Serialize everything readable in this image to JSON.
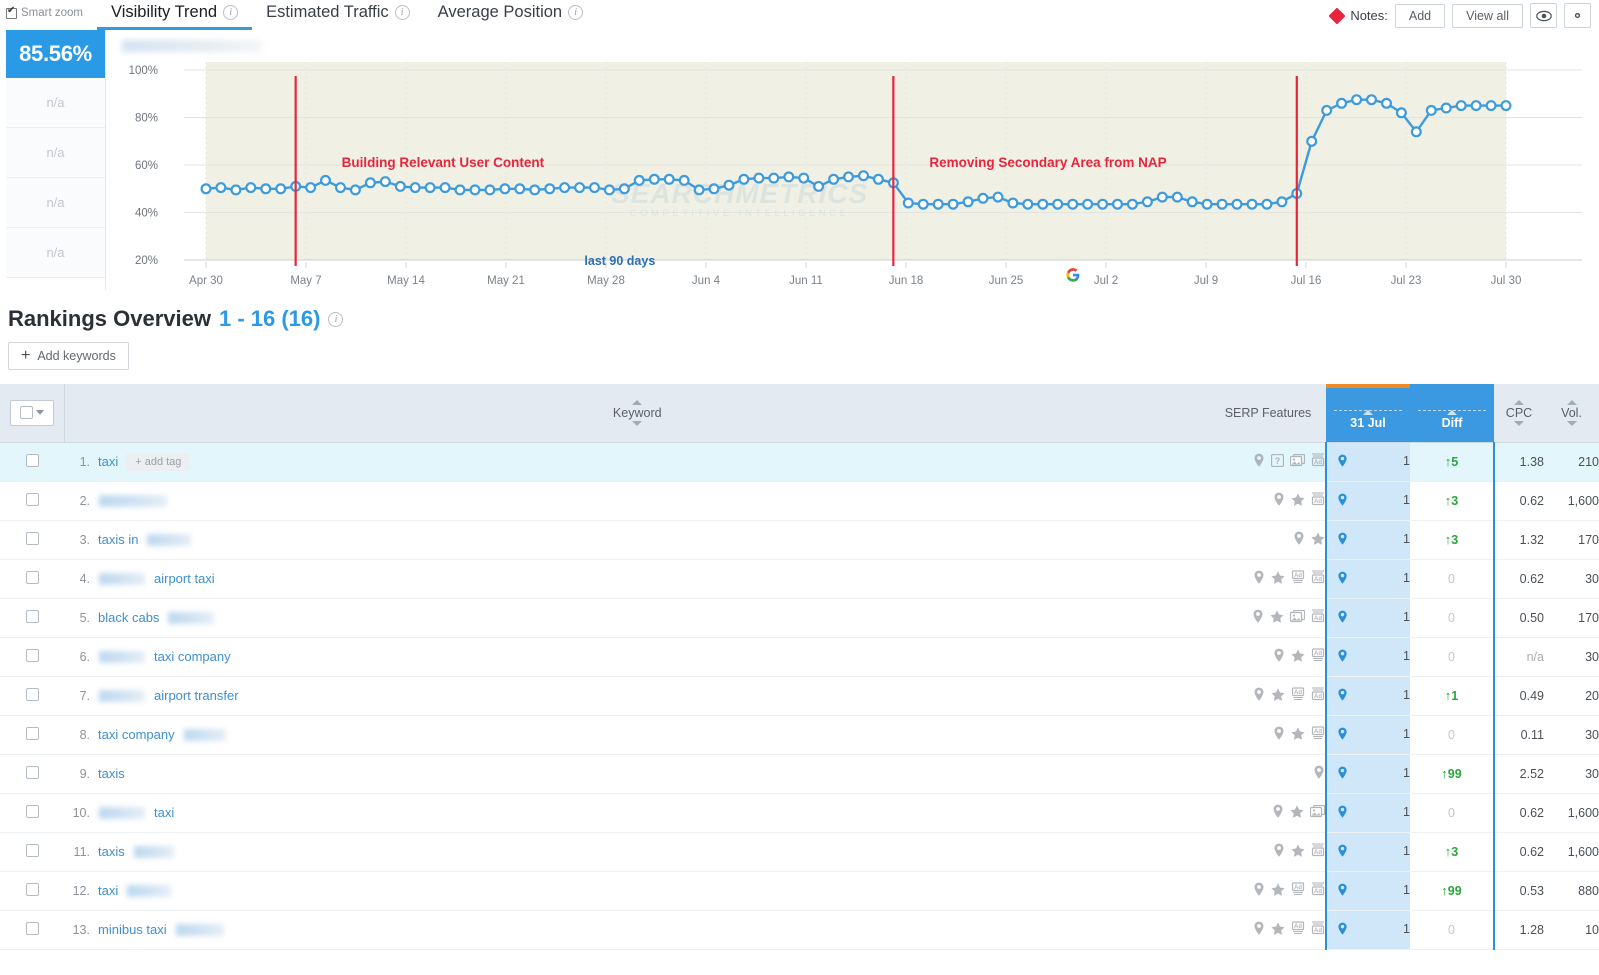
{
  "topbar": {
    "smart_zoom_label": "Smart zoom",
    "tabs": [
      {
        "label": "Visibility Trend",
        "active": true,
        "icon": "info-icon"
      },
      {
        "label": "Estimated Traffic",
        "active": false,
        "icon": "info-icon"
      },
      {
        "label": "Average Position",
        "active": false,
        "icon": "info-icon"
      }
    ],
    "notes_label": "Notes:",
    "add_label": "Add",
    "view_all_label": "View all",
    "eye_icon": "eye-icon",
    "gear_icon": "gear-icon",
    "note_marker_color": "#e8253b"
  },
  "score_rail": {
    "main_value": "85.56%",
    "main_color": "#2b9ae6",
    "na_values": [
      "n/a",
      "n/a",
      "n/a",
      "n/a"
    ]
  },
  "chart_data": {
    "type": "line",
    "title": "",
    "xlabel": "",
    "ylabel": "",
    "ylim": [
      20,
      100
    ],
    "ytick_labels": [
      "100%",
      "80%",
      "60%",
      "40%",
      "20%"
    ],
    "ytick_values": [
      100,
      80,
      60,
      40,
      20
    ],
    "xtick_labels": [
      "Apr 30",
      "May 7",
      "May 14",
      "May 21",
      "May 28",
      "Jun 4",
      "Jun 11",
      "Jun 18",
      "Jun 25",
      "Jul 2",
      "Jul 9",
      "Jul 16",
      "Jul 23",
      "Jul 30"
    ],
    "grid": true,
    "legend": "none",
    "line_color": "#3d9bdc",
    "plot_band_color": "#f0f0e4",
    "series": [
      {
        "name": "Visibility",
        "values": [
          50,
          50.5,
          49.5,
          50.5,
          50,
          50,
          51,
          50.5,
          53.5,
          50.5,
          49.5,
          52.5,
          53,
          51,
          50.5,
          50.5,
          50.5,
          49.5,
          49.5,
          49.5,
          50,
          50,
          49.5,
          50,
          50.5,
          50.5,
          50.5,
          49.5,
          50,
          53.5,
          54,
          54,
          53.5,
          49.5,
          50,
          51.5,
          54,
          54.5,
          54.5,
          55,
          54.5,
          51,
          54,
          55,
          55.5,
          54,
          52.5,
          44,
          43.5,
          43.5,
          43.5,
          44.5,
          46,
          46.5,
          44,
          43.5,
          43.5,
          43.5,
          43.5,
          43.5,
          43.5,
          43.5,
          43.5,
          44.5,
          46.5,
          46.5,
          44.5,
          43.5,
          43.5,
          43.5,
          43.5,
          43.5,
          44.5,
          48,
          70,
          83,
          86,
          87.5,
          87.5,
          86,
          82,
          74,
          83,
          84,
          85,
          85,
          85,
          85
        ]
      }
    ],
    "annotations": [
      {
        "text": "Building Relevant User Content",
        "color": "#e8253b",
        "type": "vertical-line-label"
      },
      {
        "text": "Removing Secondary Area from NAP",
        "color": "#e8253b",
        "type": "vertical-line-label"
      },
      {
        "text": "last 90 days",
        "color": "#2b6fb5",
        "type": "range-label"
      }
    ],
    "markers": [
      {
        "name": "google-update-marker",
        "icon": "google-g-icon",
        "x_label": "Jul 9"
      }
    ],
    "watermark": {
      "main": "SEARCHMETRICS",
      "sub": "COMPETITIVE INTELLIGENCE"
    }
  },
  "rankings": {
    "title": "Rankings Overview",
    "count_label": "1 - 16 (16)",
    "info_icon": "info-icon",
    "add_keywords_label": "Add keywords",
    "columns": {
      "select": "",
      "keyword": "Keyword",
      "serp_features": "SERP Features",
      "date": "31 Jul",
      "diff": "Diff",
      "cpc": "CPC",
      "vol": "Vol."
    },
    "rows": [
      {
        "num": "1.",
        "kw_pre": "taxi",
        "blur_w": 0,
        "kw_post": "",
        "add_tag": "+ add tag",
        "serp": [
          "pin-icon",
          "question-icon",
          "image-icon",
          "ad-icon"
        ],
        "rank": "1",
        "diff": "5",
        "diff_dir": "up",
        "cpc": "1.38",
        "vol": "210",
        "highlight": true
      },
      {
        "num": "2.",
        "kw_pre": "",
        "blur_w": 68,
        "kw_post": "",
        "add_tag": "",
        "serp": [
          "pin-icon",
          "star-icon",
          "ad-icon"
        ],
        "rank": "1",
        "diff": "3",
        "diff_dir": "up",
        "cpc": "0.62",
        "vol": "1,600",
        "highlight": false
      },
      {
        "num": "3.",
        "kw_pre": "taxis in",
        "blur_w": 44,
        "kw_post": "",
        "add_tag": "",
        "serp": [
          "pin-icon",
          "star-icon"
        ],
        "rank": "1",
        "diff": "3",
        "diff_dir": "up",
        "cpc": "1.32",
        "vol": "170",
        "highlight": false
      },
      {
        "num": "4.",
        "kw_pre": "",
        "blur_w": 46,
        "kw_post": "airport taxi",
        "add_tag": "",
        "serp": [
          "pin-icon",
          "star-icon",
          "ad2-icon",
          "ad-icon"
        ],
        "rank": "1",
        "diff": "0",
        "diff_dir": "zero",
        "cpc": "0.62",
        "vol": "30",
        "highlight": false
      },
      {
        "num": "5.",
        "kw_pre": "black cabs",
        "blur_w": 46,
        "kw_post": "",
        "add_tag": "",
        "serp": [
          "pin-icon",
          "star-icon",
          "image-icon",
          "ad-icon"
        ],
        "rank": "1",
        "diff": "0",
        "diff_dir": "zero",
        "cpc": "0.50",
        "vol": "170",
        "highlight": false
      },
      {
        "num": "6.",
        "kw_pre": "",
        "blur_w": 46,
        "kw_post": "taxi company",
        "add_tag": "",
        "serp": [
          "pin-icon",
          "star-icon",
          "ad2-icon"
        ],
        "rank": "1",
        "diff": "0",
        "diff_dir": "zero",
        "cpc": "n/a",
        "vol": "30",
        "highlight": false
      },
      {
        "num": "7.",
        "kw_pre": "",
        "blur_w": 46,
        "kw_post": "airport transfer",
        "add_tag": "",
        "serp": [
          "pin-icon",
          "star-icon",
          "ad2-icon",
          "ad-icon"
        ],
        "rank": "1",
        "diff": "1",
        "diff_dir": "up",
        "cpc": "0.49",
        "vol": "20",
        "highlight": false
      },
      {
        "num": "8.",
        "kw_pre": "taxi company",
        "blur_w": 42,
        "kw_post": "",
        "add_tag": "",
        "serp": [
          "pin-icon",
          "star-icon",
          "ad2-icon"
        ],
        "rank": "1",
        "diff": "0",
        "diff_dir": "zero",
        "cpc": "0.11",
        "vol": "30",
        "highlight": false
      },
      {
        "num": "9.",
        "kw_pre": "taxis",
        "blur_w": 0,
        "kw_post": "",
        "add_tag": "",
        "serp": [
          "pin-icon"
        ],
        "rank": "1",
        "diff": "99",
        "diff_dir": "up",
        "cpc": "2.52",
        "vol": "30",
        "highlight": false
      },
      {
        "num": "10.",
        "kw_pre": "",
        "blur_w": 46,
        "kw_post": "taxi",
        "add_tag": "",
        "serp": [
          "pin-icon",
          "star-icon",
          "image-icon"
        ],
        "rank": "1",
        "diff": "0",
        "diff_dir": "zero",
        "cpc": "0.62",
        "vol": "1,600",
        "highlight": false
      },
      {
        "num": "11.",
        "kw_pre": "taxis",
        "blur_w": 40,
        "kw_post": "",
        "add_tag": "",
        "serp": [
          "pin-icon",
          "star-icon",
          "ad-icon"
        ],
        "rank": "1",
        "diff": "3",
        "diff_dir": "up",
        "cpc": "0.62",
        "vol": "1,600",
        "highlight": false
      },
      {
        "num": "12.",
        "kw_pre": "taxi",
        "blur_w": 44,
        "kw_post": "",
        "add_tag": "",
        "serp": [
          "pin-icon",
          "star-icon",
          "ad2-icon",
          "ad-icon"
        ],
        "rank": "1",
        "diff": "99",
        "diff_dir": "up",
        "cpc": "0.53",
        "vol": "880",
        "highlight": false
      },
      {
        "num": "13.",
        "kw_pre": "minibus taxi",
        "blur_w": 48,
        "kw_post": "",
        "add_tag": "",
        "serp": [
          "pin-icon",
          "star-icon",
          "ad2-icon",
          "ad-icon"
        ],
        "rank": "1",
        "diff": "0",
        "diff_dir": "zero",
        "cpc": "1.28",
        "vol": "10",
        "highlight": false
      }
    ]
  }
}
